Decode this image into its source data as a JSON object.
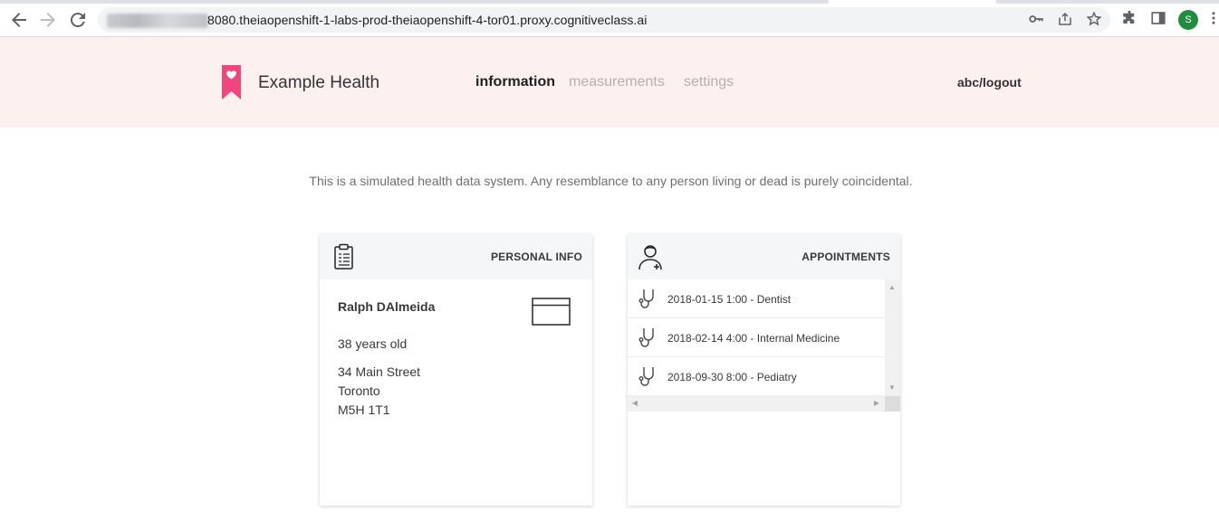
{
  "browser": {
    "url": "8080.theiaopenshift-1-labs-prod-theiaopenshift-4-tor01.proxy.cognitiveclass.ai",
    "profile_initial": "S",
    "profile_color": "#1e8e3e"
  },
  "header": {
    "brand": "Example Health",
    "brand_color": "#f0467d",
    "nav": {
      "information": "information",
      "measurements": "measurements",
      "settings": "settings"
    },
    "logout": "abc/logout"
  },
  "disclaimer": "This is a simulated health data system. Any resemblance to any person living or dead is purely coincidental.",
  "personal_info": {
    "title": "PERSONAL INFO",
    "name": "Ralph DAlmeida",
    "age": "38 years old",
    "street": "34 Main Street",
    "city": "Toronto",
    "postal": "M5H 1T1"
  },
  "appointments": {
    "title": "APPOINTMENTS",
    "items": [
      "2018-01-15 1:00 - Dentist",
      "2018-02-14 4:00 - Internal Medicine",
      "2018-09-30 8:00 - Pediatry"
    ]
  }
}
